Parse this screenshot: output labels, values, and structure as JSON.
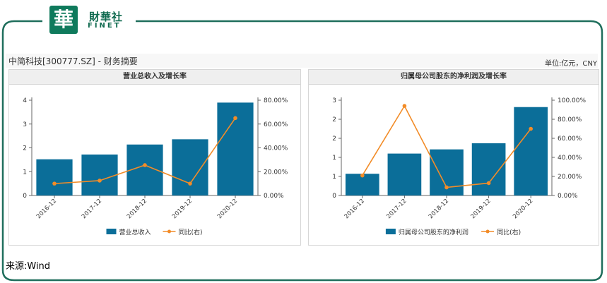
{
  "brand": {
    "logo_char": "華",
    "name_cn": "財華社",
    "name_en": "FINET",
    "accent": "#0f7a5c"
  },
  "header": {
    "title": "中简科技[300777.SZ] - 财务摘要",
    "unit": "单位:亿元，CNY"
  },
  "colors": {
    "bar": "#0b6e99",
    "line": "#f28c28",
    "axis": "#666666",
    "grid": "#e6e6e6"
  },
  "chart_data": [
    {
      "type": "bar",
      "title": "营业总收入及增长率",
      "categories": [
        "2016-12",
        "2017-12",
        "2018-12",
        "2019-12",
        "2020-12"
      ],
      "y_left": {
        "ticks": [
          "0",
          "1",
          "2",
          "3",
          "4"
        ],
        "ylim": [
          0,
          4
        ]
      },
      "y_right": {
        "ticks": [
          "0.00%",
          "20.00%",
          "40.00%",
          "60.00%",
          "80.00%"
        ],
        "ylim": [
          0,
          80
        ]
      },
      "series": [
        {
          "name": "营业总收入",
          "type": "bar",
          "axis": "left",
          "values": [
            1.52,
            1.72,
            2.14,
            2.36,
            3.9
          ]
        },
        {
          "name": "同比(右)",
          "type": "line",
          "axis": "right",
          "values": [
            10,
            12.5,
            25.5,
            10,
            65
          ]
        }
      ],
      "legend_position": "bottom"
    },
    {
      "type": "bar",
      "title": "归属母公司股东的净利润及增长率",
      "categories": [
        "2016-12",
        "2017-12",
        "2018-12",
        "2019-12",
        "2020-12"
      ],
      "y_left": {
        "ticks": [
          "0",
          "1",
          "1",
          "2",
          "2",
          "3"
        ],
        "ylim": [
          0,
          2.5
        ]
      },
      "y_right": {
        "ticks": [
          "0.00%",
          "20.00%",
          "40.00%",
          "60.00%",
          "80.00%",
          "100.00%"
        ],
        "ylim": [
          0,
          100
        ]
      },
      "series": [
        {
          "name": "归属母公司股东的净利润",
          "type": "bar",
          "axis": "left",
          "values": [
            0.57,
            1.1,
            1.21,
            1.37,
            2.32
          ]
        },
        {
          "name": "同比(右)",
          "type": "line",
          "axis": "right",
          "values": [
            21,
            94,
            8.5,
            13,
            70
          ]
        }
      ],
      "legend_position": "bottom"
    }
  ],
  "source": "来源:Wind"
}
